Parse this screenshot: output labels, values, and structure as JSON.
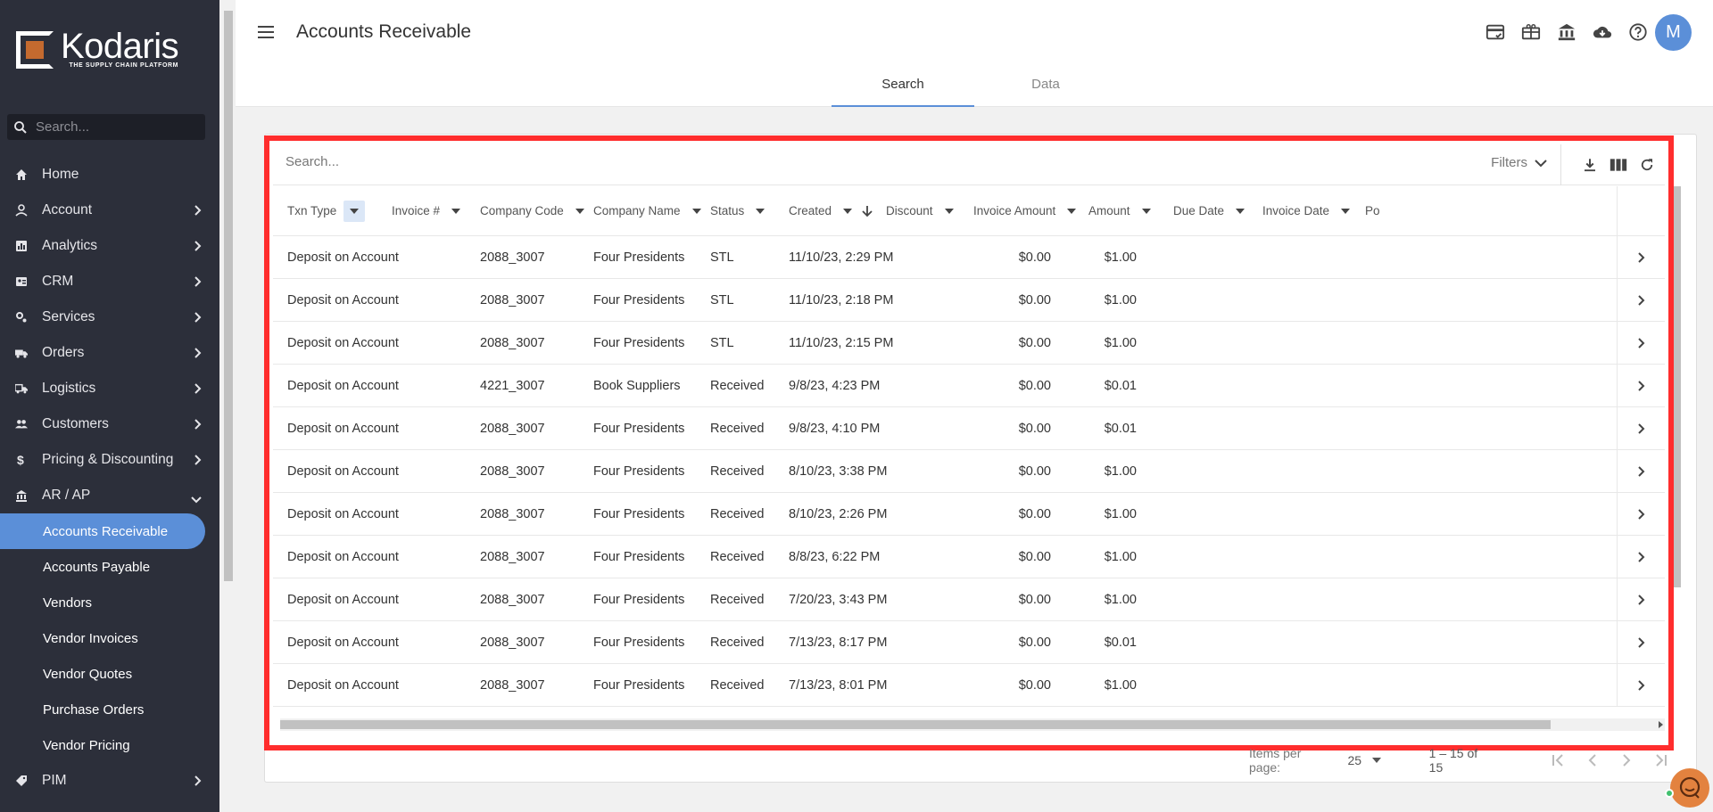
{
  "brand": {
    "name": "Kodaris",
    "tagline": "THE SUPPLY CHAIN PLATFORM"
  },
  "sidebar": {
    "search_placeholder": "Search...",
    "items": [
      {
        "label": "Home",
        "icon": "home-icon",
        "chevron": false
      },
      {
        "label": "Account",
        "icon": "person-icon",
        "chevron": true
      },
      {
        "label": "Analytics",
        "icon": "analytics-icon",
        "chevron": true
      },
      {
        "label": "CRM",
        "icon": "crm-icon",
        "chevron": true
      },
      {
        "label": "Services",
        "icon": "services-icon",
        "chevron": true
      },
      {
        "label": "Orders",
        "icon": "truck-icon",
        "chevron": true
      },
      {
        "label": "Logistics",
        "icon": "logistics-icon",
        "chevron": true
      },
      {
        "label": "Customers",
        "icon": "people-icon",
        "chevron": true
      },
      {
        "label": "Pricing & Discounting",
        "icon": "dollar-icon",
        "chevron": true
      },
      {
        "label": "AR / AP",
        "icon": "bank-icon",
        "chevron": true
      }
    ],
    "subitems": [
      {
        "label": "Accounts Receivable",
        "active": true
      },
      {
        "label": "Accounts Payable",
        "active": false
      },
      {
        "label": "Vendors",
        "active": false
      },
      {
        "label": "Vendor Invoices",
        "active": false
      },
      {
        "label": "Vendor Quotes",
        "active": false
      },
      {
        "label": "Purchase Orders",
        "active": false
      },
      {
        "label": "Vendor Pricing",
        "active": false
      }
    ],
    "after": [
      {
        "label": "PIM",
        "icon": "tag-icon",
        "chevron": true
      }
    ]
  },
  "header": {
    "title": "Accounts Receivable",
    "avatar": "M",
    "tabs": [
      {
        "label": "Search",
        "active": true
      },
      {
        "label": "Data",
        "active": false
      }
    ]
  },
  "table": {
    "search_placeholder": "Search...",
    "filters_label": "Filters",
    "columns": [
      "Txn Type",
      "Invoice #",
      "Company Code",
      "Company Name",
      "Status",
      "Created",
      "Discount",
      "Invoice Amount",
      "Amount",
      "Due Date",
      "Invoice Date",
      "Po"
    ],
    "rows": [
      [
        "Deposit on Account",
        "",
        "2088_3007",
        "Four Presidents",
        "STL",
        "11/10/23, 2:29 PM",
        "",
        "$0.00",
        "$1.00",
        "",
        ""
      ],
      [
        "Deposit on Account",
        "",
        "2088_3007",
        "Four Presidents",
        "STL",
        "11/10/23, 2:18 PM",
        "",
        "$0.00",
        "$1.00",
        "",
        ""
      ],
      [
        "Deposit on Account",
        "",
        "2088_3007",
        "Four Presidents",
        "STL",
        "11/10/23, 2:15 PM",
        "",
        "$0.00",
        "$1.00",
        "",
        ""
      ],
      [
        "Deposit on Account",
        "",
        "4221_3007",
        "Book Suppliers",
        "Received",
        "9/8/23, 4:23 PM",
        "",
        "$0.00",
        "$0.01",
        "",
        ""
      ],
      [
        "Deposit on Account",
        "",
        "2088_3007",
        "Four Presidents",
        "Received",
        "9/8/23, 4:10 PM",
        "",
        "$0.00",
        "$0.01",
        "",
        ""
      ],
      [
        "Deposit on Account",
        "",
        "2088_3007",
        "Four Presidents",
        "Received",
        "8/10/23, 3:38 PM",
        "",
        "$0.00",
        "$1.00",
        "",
        ""
      ],
      [
        "Deposit on Account",
        "",
        "2088_3007",
        "Four Presidents",
        "Received",
        "8/10/23, 2:26 PM",
        "",
        "$0.00",
        "$1.00",
        "",
        ""
      ],
      [
        "Deposit on Account",
        "",
        "2088_3007",
        "Four Presidents",
        "Received",
        "8/8/23, 6:22 PM",
        "",
        "$0.00",
        "$1.00",
        "",
        ""
      ],
      [
        "Deposit on Account",
        "",
        "2088_3007",
        "Four Presidents",
        "Received",
        "7/20/23, 3:43 PM",
        "",
        "$0.00",
        "$1.00",
        "",
        ""
      ],
      [
        "Deposit on Account",
        "",
        "2088_3007",
        "Four Presidents",
        "Received",
        "7/13/23, 8:17 PM",
        "",
        "$0.00",
        "$0.01",
        "",
        ""
      ],
      [
        "Deposit on Account",
        "",
        "2088_3007",
        "Four Presidents",
        "Received",
        "7/13/23, 8:01 PM",
        "",
        "$0.00",
        "$1.00",
        "",
        ""
      ]
    ]
  },
  "paginator": {
    "label": "Items per page:",
    "page_size": "25",
    "range": "1 – 15 of 15"
  },
  "colors": {
    "sidebar_bg": "#2c2f3a",
    "accent": "#5b8fd8",
    "highlight": "#ff2d2d",
    "chat": "#e3823f"
  }
}
